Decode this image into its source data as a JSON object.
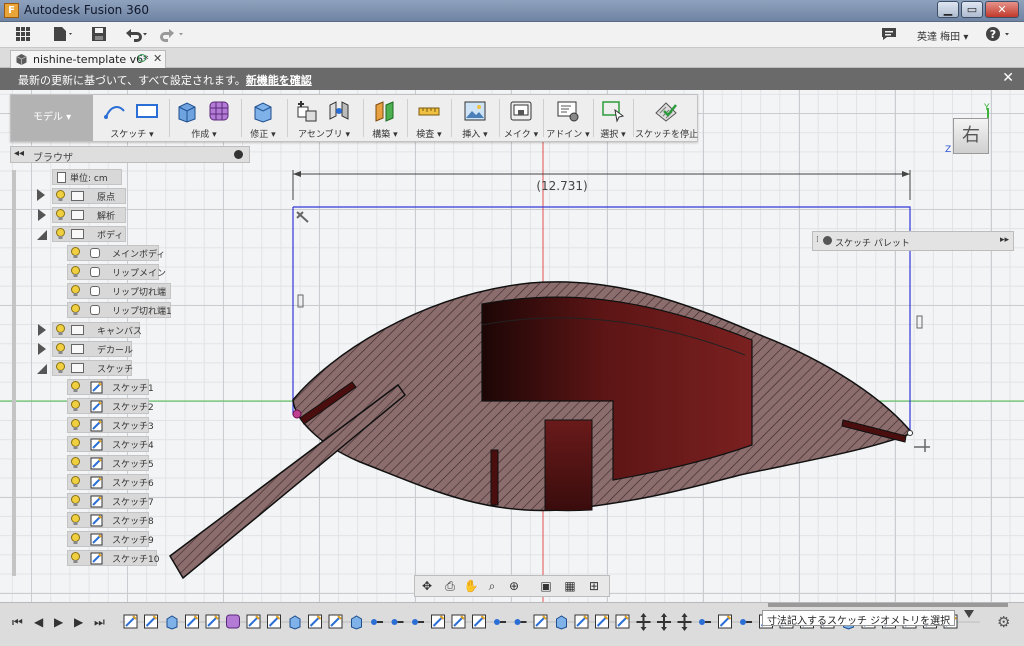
{
  "window": {
    "title": "Autodesk Fusion 360",
    "app_icon": "F",
    "controls": [
      "minimize",
      "maximize",
      "close"
    ]
  },
  "quick_access": {
    "icons": [
      "app-grid-icon",
      "file-icon",
      "save-icon",
      "undo-icon",
      "redo-icon"
    ],
    "user_name": "英達 梅田 ▾",
    "help": "?"
  },
  "document_tab": {
    "name": "nishine-template v6*",
    "close": "✕"
  },
  "notification": {
    "message": "最新の更新に基づいて、すべて設定されます。",
    "link": "新機能を確認",
    "close": "✕"
  },
  "ribbon": {
    "workspace": "モデル ▾",
    "groups": [
      {
        "id": "sketch",
        "label": "スケッチ ▾"
      },
      {
        "id": "create",
        "label": "作成 ▾"
      },
      {
        "id": "modify",
        "label": "修正 ▾"
      },
      {
        "id": "assemble",
        "label": "アセンブリ ▾"
      },
      {
        "id": "construct",
        "label": "構築 ▾"
      },
      {
        "id": "inspect",
        "label": "検査 ▾"
      },
      {
        "id": "insert",
        "label": "挿入 ▾"
      },
      {
        "id": "make",
        "label": "メイク ▾"
      },
      {
        "id": "addins",
        "label": "アドイン ▾"
      },
      {
        "id": "select",
        "label": "選択 ▾"
      },
      {
        "id": "stop_sketch",
        "label": "スケッチを停止"
      }
    ]
  },
  "browser": {
    "title": "ブラウザ",
    "units": "単位: cm",
    "top_nodes": [
      {
        "label": "原点",
        "expand": "closed"
      },
      {
        "label": "解析",
        "expand": "closed"
      },
      {
        "label": "ボディ",
        "expand": "open"
      }
    ],
    "bodies": [
      "メインボディ",
      "リップメイン",
      "リップ切れ端",
      "リップ切れ端1"
    ],
    "mid_nodes": [
      {
        "label": "キャンバス",
        "expand": "closed"
      },
      {
        "label": "デカール",
        "expand": "closed"
      },
      {
        "label": "スケッチ",
        "expand": "open"
      }
    ],
    "sketches": [
      "スケッチ1",
      "スケッチ2",
      "スケッチ3",
      "スケッチ4",
      "スケッチ5",
      "スケッチ6",
      "スケッチ7",
      "スケッチ8",
      "スケッチ9",
      "スケッチ10"
    ]
  },
  "viewport": {
    "dimension": "(12.731)",
    "viewcube_face": "右",
    "axis_labels": {
      "y": "Y",
      "z": "Z"
    },
    "sketch_palette": "スケッチ パレット",
    "colors": {
      "body_fill": "#8a6b6b",
      "cavity": "#5c1212",
      "sketch_line": "#2c34d6",
      "x_axis": "#3cb43c",
      "y_axis": "#d23a3a"
    }
  },
  "navbar": {
    "icons": [
      "orbit-icon",
      "look-at-icon",
      "pan-icon",
      "zoom-window-icon",
      "zoom-icon",
      "display-settings-icon",
      "grid-icon",
      "viewports-icon"
    ]
  },
  "timeline": {
    "controls": [
      "⏮",
      "◀",
      "▶",
      "▶",
      "⏭"
    ],
    "status_tooltip": "寸法記入するスケッチ ジオメトリを選択"
  }
}
